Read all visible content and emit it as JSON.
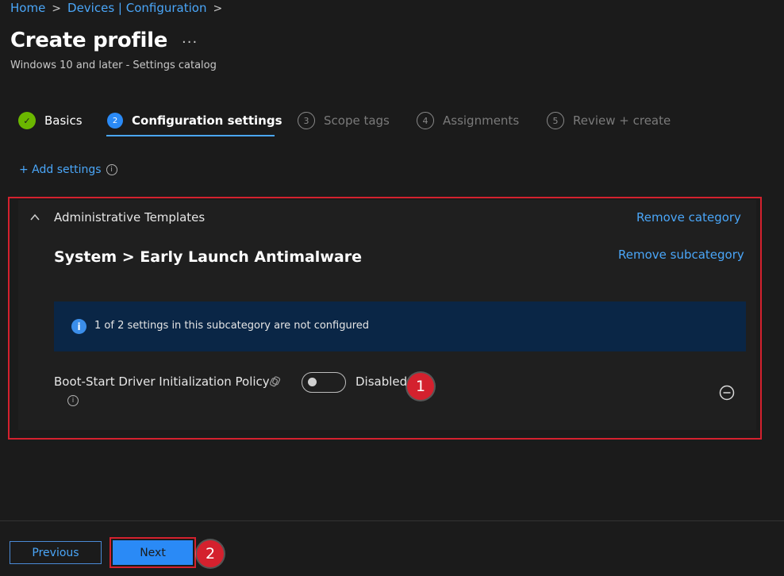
{
  "breadcrumb": {
    "items": [
      "Home",
      "Devices | Configuration"
    ]
  },
  "header": {
    "title": "Create profile",
    "more": "...",
    "subtitle": "Windows 10 and later - Settings catalog"
  },
  "steps": [
    {
      "label": "Basics",
      "state": "done",
      "marker": "✓"
    },
    {
      "label": "Configuration settings",
      "state": "current",
      "marker": "2"
    },
    {
      "label": "Scope tags",
      "state": "pending",
      "marker": "3"
    },
    {
      "label": "Assignments",
      "state": "pending",
      "marker": "4"
    },
    {
      "label": "Review + create",
      "state": "pending",
      "marker": "5"
    }
  ],
  "add_settings": {
    "label": "+ Add settings"
  },
  "category": {
    "title": "Administrative Templates",
    "remove_category": "Remove category",
    "subcategory": "System > Early Launch Antimalware",
    "remove_subcategory": "Remove subcategory",
    "info_banner": "1 of 2 settings in this subcategory are not configured",
    "setting": {
      "name": "Boot-Start Driver Initialization Policy",
      "toggle_on": false,
      "toggle_label": "Disabled"
    }
  },
  "annotations": {
    "badge1": "1",
    "badge2": "2",
    "highlight_color": "#d4212e"
  },
  "footer": {
    "previous_label": "Previous",
    "next_label": "Next"
  },
  "colors": {
    "accent": "#2a8af6",
    "link": "#4aa6f8",
    "success": "#6bb700",
    "background": "#1b1b1b",
    "banner": "#0a2646"
  }
}
